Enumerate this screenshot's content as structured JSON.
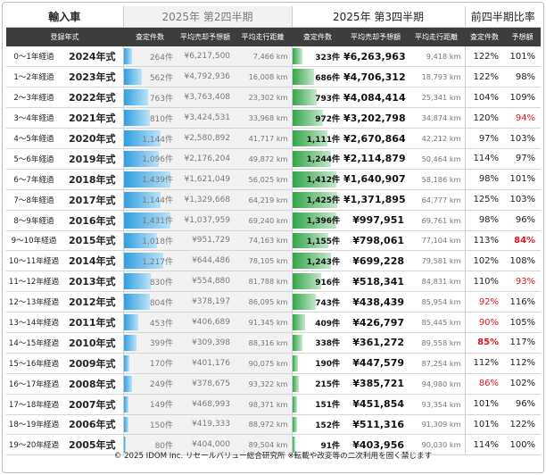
{
  "header": {
    "title": "輸入車",
    "q2_label": "2025年 第2四半期",
    "q3_label": "2025年 第3四半期",
    "ratio_label": "前四半期比率"
  },
  "columns": {
    "model_year": "登録年式",
    "q2_count": "査定件数",
    "q2_price": "平均売却予想額",
    "q2_distance": "平均走行距離",
    "q3_count": "査定件数",
    "q3_price": "平均売却予想額",
    "q3_distance": "平均走行距離",
    "ratio_count": "査定件数",
    "ratio_price": "予想額"
  },
  "rows": [
    {
      "age": "0〜1年経過",
      "model": "2024年式",
      "q2_count": "264件",
      "q2_price": "¥6,217,500",
      "q2_dist": "7,466 km",
      "q3_count": "323件",
      "q3_price": "¥6,263,963",
      "q3_dist": "9,418 km",
      "r_count": "122%",
      "r_price": "101%",
      "q2_level": 264,
      "q3_level": 323,
      "r_count_hl": "",
      "r_price_hl": ""
    },
    {
      "age": "1〜2年経過",
      "model": "2023年式",
      "q2_count": "562件",
      "q2_price": "¥4,792,936",
      "q2_dist": "16,008 km",
      "q3_count": "686件",
      "q3_price": "¥4,706,312",
      "q3_dist": "18,793 km",
      "r_count": "122%",
      "r_price": "98%",
      "q2_level": 562,
      "q3_level": 686,
      "r_count_hl": "",
      "r_price_hl": ""
    },
    {
      "age": "2〜3年経過",
      "model": "2022年式",
      "q2_count": "763件",
      "q2_price": "¥3,763,408",
      "q2_dist": "23,302 km",
      "q3_count": "793件",
      "q3_price": "¥4,084,414",
      "q3_dist": "25,341 km",
      "r_count": "104%",
      "r_price": "109%",
      "q2_level": 763,
      "q3_level": 793,
      "r_count_hl": "",
      "r_price_hl": ""
    },
    {
      "age": "3〜4年経過",
      "model": "2021年式",
      "q2_count": "810件",
      "q2_price": "¥3,424,531",
      "q2_dist": "33,968 km",
      "q3_count": "972件",
      "q3_price": "¥3,202,798",
      "q3_dist": "34,874 km",
      "r_count": "120%",
      "r_price": "94%",
      "q2_level": 810,
      "q3_level": 972,
      "r_count_hl": "",
      "r_price_hl": "red"
    },
    {
      "age": "4〜5年経過",
      "model": "2020年式",
      "q2_count": "1,144件",
      "q2_price": "¥2,580,892",
      "q2_dist": "41,717 km",
      "q3_count": "1,111件",
      "q3_price": "¥2,670,864",
      "q3_dist": "42,212 km",
      "r_count": "97%",
      "r_price": "103%",
      "q2_level": 1144,
      "q3_level": 1111,
      "r_count_hl": "",
      "r_price_hl": ""
    },
    {
      "age": "5〜6年経過",
      "model": "2019年式",
      "q2_count": "1,096件",
      "q2_price": "¥2,176,204",
      "q2_dist": "49,872 km",
      "q3_count": "1,244件",
      "q3_price": "¥2,114,879",
      "q3_dist": "50,464 km",
      "r_count": "114%",
      "r_price": "97%",
      "q2_level": 1096,
      "q3_level": 1244,
      "r_count_hl": "",
      "r_price_hl": ""
    },
    {
      "age": "6〜7年経過",
      "model": "2018年式",
      "q2_count": "1,439件",
      "q2_price": "¥1,621,049",
      "q2_dist": "56,025 km",
      "q3_count": "1,412件",
      "q3_price": "¥1,640,907",
      "q3_dist": "58,186 km",
      "r_count": "98%",
      "r_price": "101%",
      "q2_level": 1439,
      "q3_level": 1412,
      "r_count_hl": "",
      "r_price_hl": ""
    },
    {
      "age": "7〜8年経過",
      "model": "2017年式",
      "q2_count": "1,144件",
      "q2_price": "¥1,329,668",
      "q2_dist": "64,219 km",
      "q3_count": "1,425件",
      "q3_price": "¥1,371,895",
      "q3_dist": "64,777 km",
      "r_count": "125%",
      "r_price": "103%",
      "q2_level": 1144,
      "q3_level": 1425,
      "r_count_hl": "",
      "r_price_hl": ""
    },
    {
      "age": "8〜9年経過",
      "model": "2016年式",
      "q2_count": "1,431件",
      "q2_price": "¥1,037,959",
      "q2_dist": "69,240 km",
      "q3_count": "1,396件",
      "q3_price": "¥997,951",
      "q3_dist": "69,761 km",
      "r_count": "98%",
      "r_price": "96%",
      "q2_level": 1431,
      "q3_level": 1396,
      "r_count_hl": "",
      "r_price_hl": ""
    },
    {
      "age": "9〜10年経過",
      "model": "2015年式",
      "q2_count": "1,018件",
      "q2_price": "¥951,729",
      "q2_dist": "74,163 km",
      "q3_count": "1,155件",
      "q3_price": "¥798,061",
      "q3_dist": "77,104 km",
      "r_count": "113%",
      "r_price": "84%",
      "q2_level": 1018,
      "q3_level": 1155,
      "r_count_hl": "",
      "r_price_hl": "redb"
    },
    {
      "age": "10〜11年経過",
      "model": "2014年式",
      "q2_count": "1,217件",
      "q2_price": "¥644,486",
      "q2_dist": "78,105 km",
      "q3_count": "1,243件",
      "q3_price": "¥699,228",
      "q3_dist": "79,581 km",
      "r_count": "102%",
      "r_price": "108%",
      "q2_level": 1217,
      "q3_level": 1243,
      "r_count_hl": "",
      "r_price_hl": ""
    },
    {
      "age": "11〜12年経過",
      "model": "2013年式",
      "q2_count": "830件",
      "q2_price": "¥554,880",
      "q2_dist": "81,788 km",
      "q3_count": "916件",
      "q3_price": "¥518,341",
      "q3_dist": "84,831 km",
      "r_count": "110%",
      "r_price": "93%",
      "q2_level": 830,
      "q3_level": 916,
      "r_count_hl": "",
      "r_price_hl": "red"
    },
    {
      "age": "12〜13年経過",
      "model": "2012年式",
      "q2_count": "804件",
      "q2_price": "¥378,197",
      "q2_dist": "86,095 km",
      "q3_count": "743件",
      "q3_price": "¥438,439",
      "q3_dist": "85,954 km",
      "r_count": "92%",
      "r_price": "116%",
      "q2_level": 804,
      "q3_level": 743,
      "r_count_hl": "red",
      "r_price_hl": ""
    },
    {
      "age": "13〜14年経過",
      "model": "2011年式",
      "q2_count": "453件",
      "q2_price": "¥406,689",
      "q2_dist": "91,345 km",
      "q3_count": "409件",
      "q3_price": "¥426,797",
      "q3_dist": "85,445 km",
      "r_count": "90%",
      "r_price": "105%",
      "q2_level": 453,
      "q3_level": 409,
      "r_count_hl": "red",
      "r_price_hl": ""
    },
    {
      "age": "14〜15年経過",
      "model": "2010年式",
      "q2_count": "399件",
      "q2_price": "¥309,398",
      "q2_dist": "88,316 km",
      "q3_count": "338件",
      "q3_price": "¥361,272",
      "q3_dist": "89,558 km",
      "r_count": "85%",
      "r_price": "117%",
      "q2_level": 399,
      "q3_level": 338,
      "r_count_hl": "redb",
      "r_price_hl": ""
    },
    {
      "age": "15〜16年経過",
      "model": "2009年式",
      "q2_count": "170件",
      "q2_price": "¥401,176",
      "q2_dist": "90,075 km",
      "q3_count": "190件",
      "q3_price": "¥447,579",
      "q3_dist": "87,254 km",
      "r_count": "112%",
      "r_price": "112%",
      "q2_level": 170,
      "q3_level": 190,
      "r_count_hl": "",
      "r_price_hl": ""
    },
    {
      "age": "16〜17年経過",
      "model": "2008年式",
      "q2_count": "249件",
      "q2_price": "¥378,675",
      "q2_dist": "93,322 km",
      "q3_count": "215件",
      "q3_price": "¥385,721",
      "q3_dist": "94,980 km",
      "r_count": "86%",
      "r_price": "102%",
      "q2_level": 249,
      "q3_level": 215,
      "r_count_hl": "red",
      "r_price_hl": ""
    },
    {
      "age": "17〜18年経過",
      "model": "2007年式",
      "q2_count": "149件",
      "q2_price": "¥468,993",
      "q2_dist": "98,371 km",
      "q3_count": "151件",
      "q3_price": "¥451,854",
      "q3_dist": "93,354 km",
      "r_count": "101%",
      "r_price": "96%",
      "q2_level": 149,
      "q3_level": 151,
      "r_count_hl": "",
      "r_price_hl": ""
    },
    {
      "age": "18〜19年経過",
      "model": "2006年式",
      "q2_count": "150件",
      "q2_price": "¥419,333",
      "q2_dist": "88,972 km",
      "q3_count": "152件",
      "q3_price": "¥511,316",
      "q3_dist": "91,309 km",
      "r_count": "101%",
      "r_price": "122%",
      "q2_level": 150,
      "q3_level": 152,
      "r_count_hl": "",
      "r_price_hl": ""
    },
    {
      "age": "19〜20年経過",
      "model": "2005年式",
      "q2_count": "80件",
      "q2_price": "¥404,000",
      "q2_dist": "89,504 km",
      "q3_count": "91件",
      "q3_price": "¥403,956",
      "q3_dist": "90,030 km",
      "r_count": "114%",
      "r_price": "100%",
      "q2_level": 80,
      "q3_level": 91,
      "r_count_hl": "",
      "r_price_hl": ""
    }
  ],
  "bar_scale_max": 1500,
  "colors": {
    "header_bg": "#3d3d3d",
    "q2_bar": "#2f9fe0",
    "q3_bar": "#33a548",
    "highlight_red": "#e0141c",
    "q2_bg": "#f2f2f2"
  },
  "footer": "© 2025 IDOM Inc. リセールバリュー総合研究所 ※転載や改変等の二次利用を固く禁じます"
}
